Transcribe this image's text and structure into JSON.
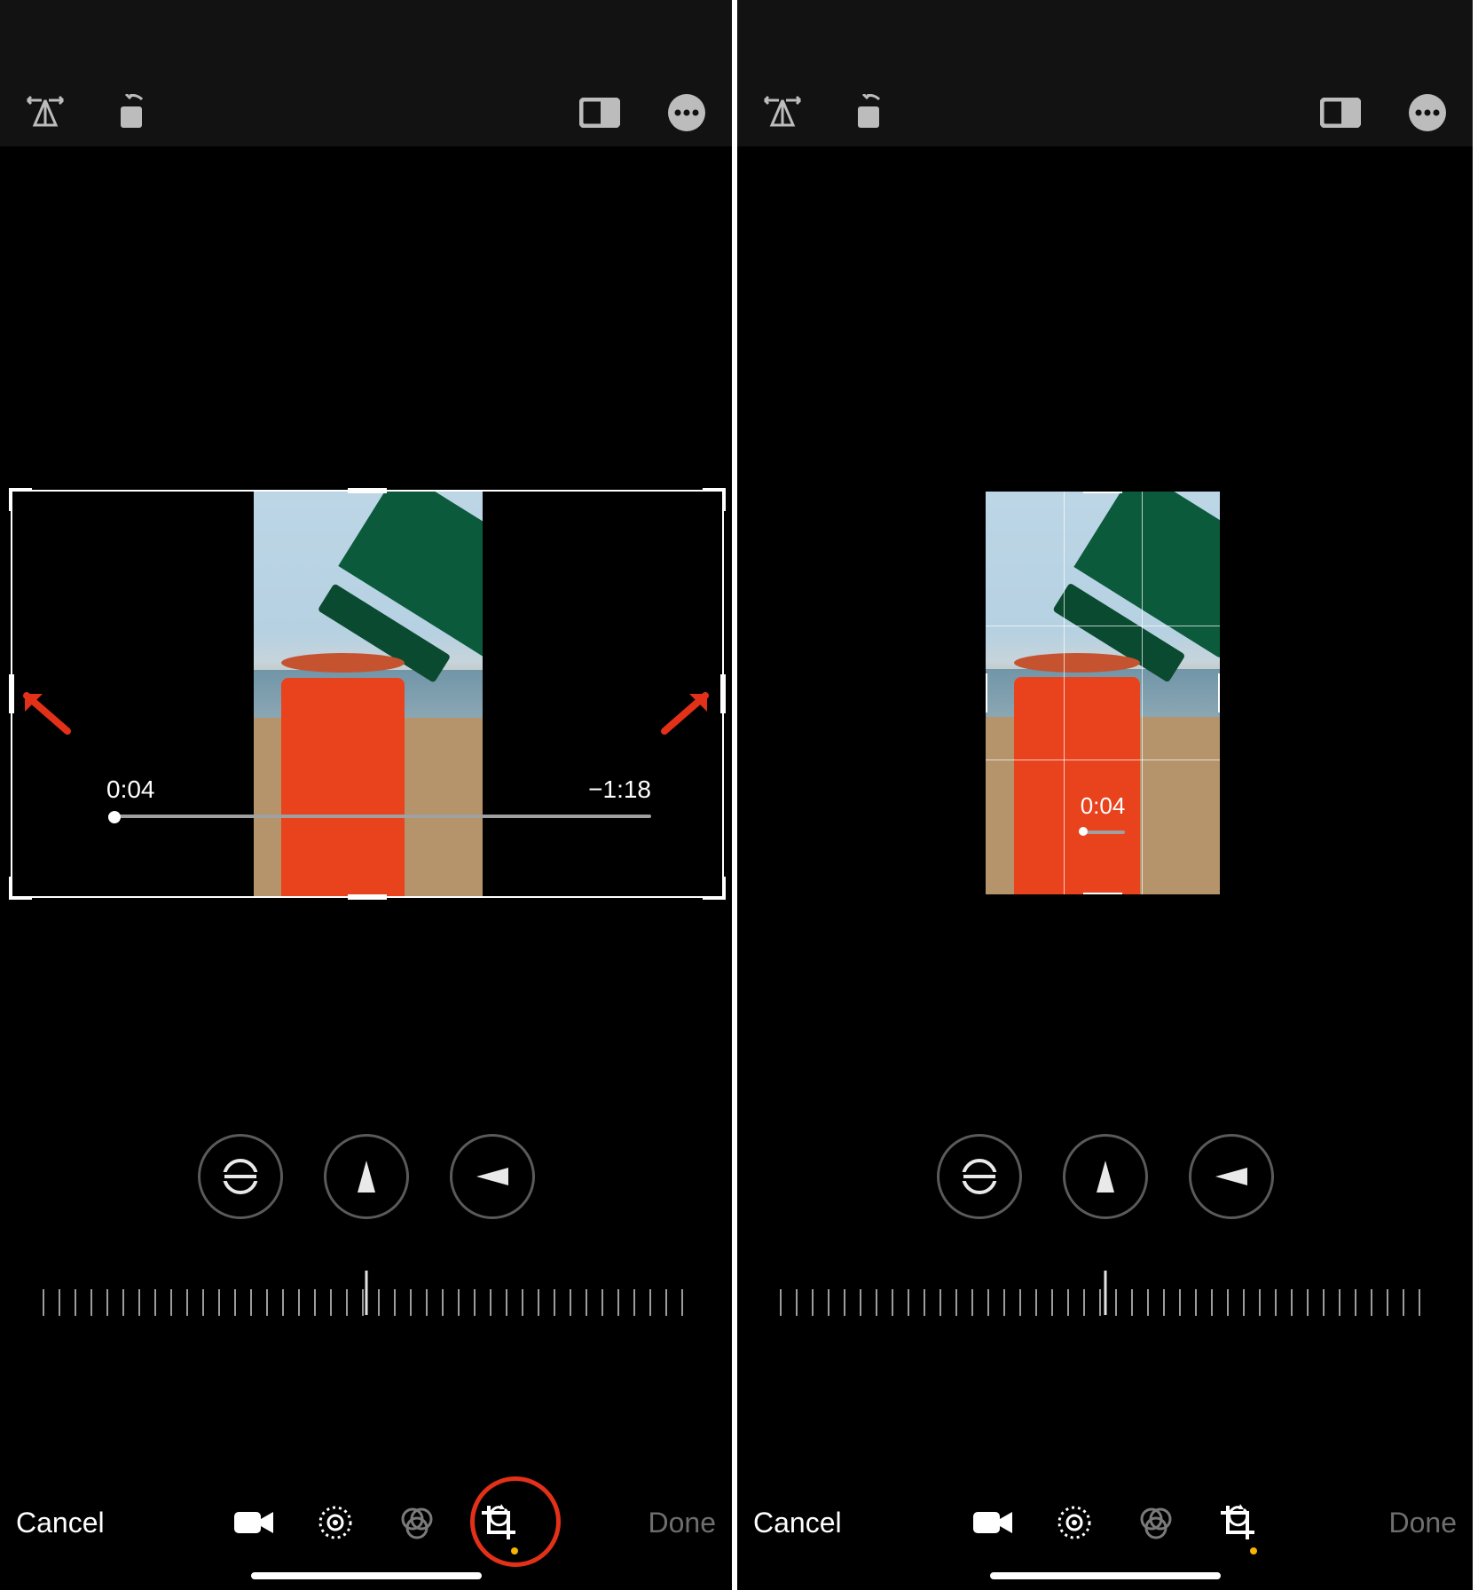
{
  "left": {
    "toolbar": {
      "flip_icon": "flip-horizontal-icon",
      "rotate_icon": "rotate-icon",
      "aspect_icon": "aspect-ratio-icon",
      "more_icon": "more-options-icon"
    },
    "playback": {
      "elapsed": "0:04",
      "remaining": "−1:18"
    },
    "adjust": {
      "straighten": "straighten",
      "vertical": "vertical-perspective",
      "horizontal": "horizontal-perspective"
    },
    "tabs": {
      "video": "video",
      "adjust": "adjust",
      "filters": "filters",
      "crop": "crop"
    },
    "cancel": "Cancel",
    "done": "Done",
    "annotation": {
      "highlight_tab": "crop"
    }
  },
  "right": {
    "toolbar": {
      "flip_icon": "flip-horizontal-icon",
      "rotate_icon": "rotate-icon",
      "aspect_icon": "aspect-ratio-icon",
      "more_icon": "more-options-icon"
    },
    "playback": {
      "elapsed": "0:04"
    },
    "adjust": {
      "straighten": "straighten",
      "vertical": "vertical-perspective",
      "horizontal": "horizontal-perspective"
    },
    "tabs": {
      "video": "video",
      "adjust": "adjust",
      "filters": "filters",
      "crop": "crop"
    },
    "cancel": "Cancel",
    "done": "Done"
  },
  "colors": {
    "accent": "#f7b500",
    "annotation": "#e33119"
  }
}
